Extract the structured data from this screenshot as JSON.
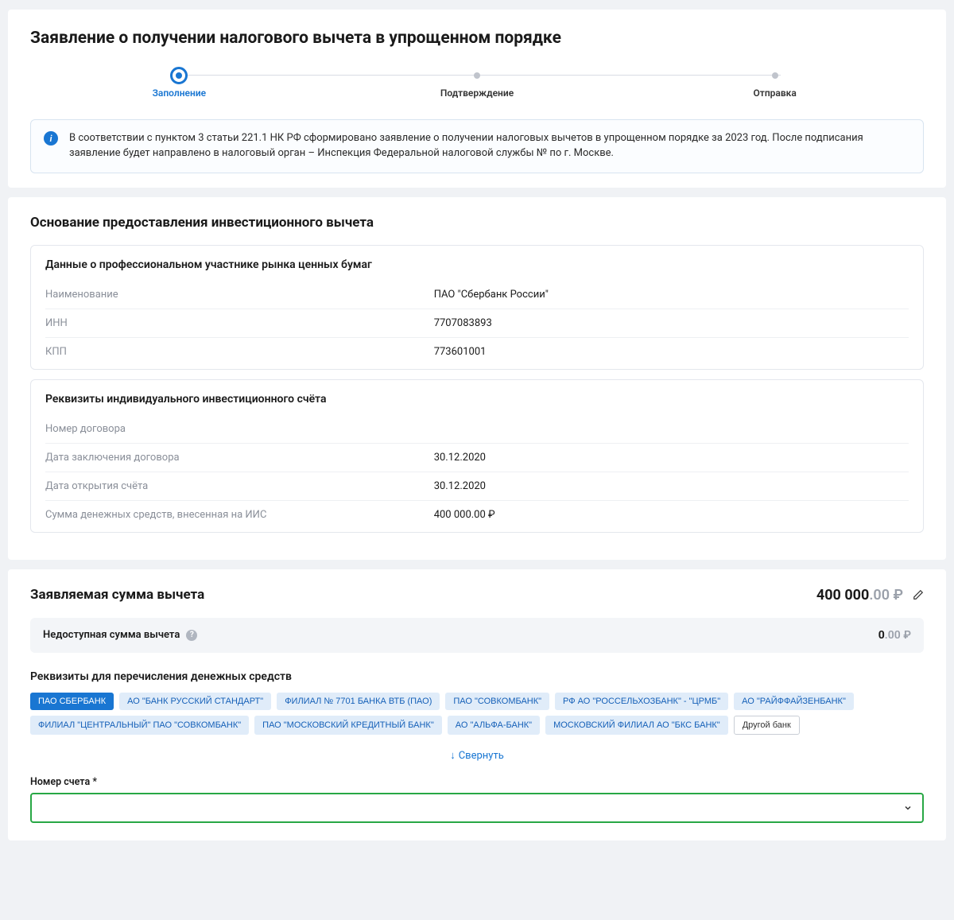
{
  "page_title": "Заявление о получении налогового вычета в упрощенном порядке",
  "steps": {
    "s1": "Заполнение",
    "s2": "Подтверждение",
    "s3": "Отправка"
  },
  "info_text": "В соответствии с пунктом 3 статьи 221.1 НК РФ сформировано заявление о получении налоговых вычетов в упрощенном порядке за 2023 год. После подписания заявление будет направлено в налоговый орган – Инспекция Федеральной налоговой службы №       по г. Москве.",
  "basis": {
    "title": "Основание предоставления инвестиционного вычета",
    "broker": {
      "title": "Данные о профессиональном участнике рынка ценных бумаг",
      "rows": [
        {
          "k": "Наименование",
          "v": "ПАО \"Сбербанк России\""
        },
        {
          "k": "ИНН",
          "v": "7707083893"
        },
        {
          "k": "КПП",
          "v": "773601001"
        }
      ]
    },
    "iis": {
      "title": "Реквизиты индивидуального инвестиционного счёта",
      "rows": [
        {
          "k": "Номер договора",
          "v": ""
        },
        {
          "k": "Дата заключения договора",
          "v": "30.12.2020"
        },
        {
          "k": "Дата открытия счёта",
          "v": "30.12.2020"
        },
        {
          "k": "Сумма денежных средств, внесенная на ИИС",
          "v": "400 000.00 ₽"
        }
      ]
    }
  },
  "claimed": {
    "title": "Заявляемая сумма вычета",
    "amount_int": "400 000",
    "amount_dec": ".00 ₽",
    "unavailable_label": "Недоступная сумма вычета",
    "unavailable_int": "0",
    "unavailable_dec": ".00 ₽"
  },
  "transfer": {
    "title": "Реквизиты для перечисления денежных средств",
    "chips": [
      "ПАО СБЕРБАНК",
      "АО \"БАНК РУССКИЙ СТАНДАРТ\"",
      "ФИЛИАЛ № 7701 БАНКА ВТБ (ПАО)",
      "ПАО \"СОВКОМБАНК\"",
      "РФ АО \"РОССЕЛЬХОЗБАНК\" - \"ЦРМБ\"",
      "АО \"РАЙФФАЙЗЕНБАНК\"",
      "ФИЛИАЛ \"ЦЕНТРАЛЬНЫЙ\" ПАО \"СОВКОМБАНК\"",
      "ПАО \"МОСКОВСКИЙ КРЕДИТНЫЙ БАНК\"",
      "АО \"АЛЬФА-БАНК\"",
      "МОСКОВСКИЙ ФИЛИАЛ АО \"БКС БАНК\""
    ],
    "other_chip": "Другой банк",
    "collapse": "Свернуть",
    "account_label": "Номер счета *"
  }
}
